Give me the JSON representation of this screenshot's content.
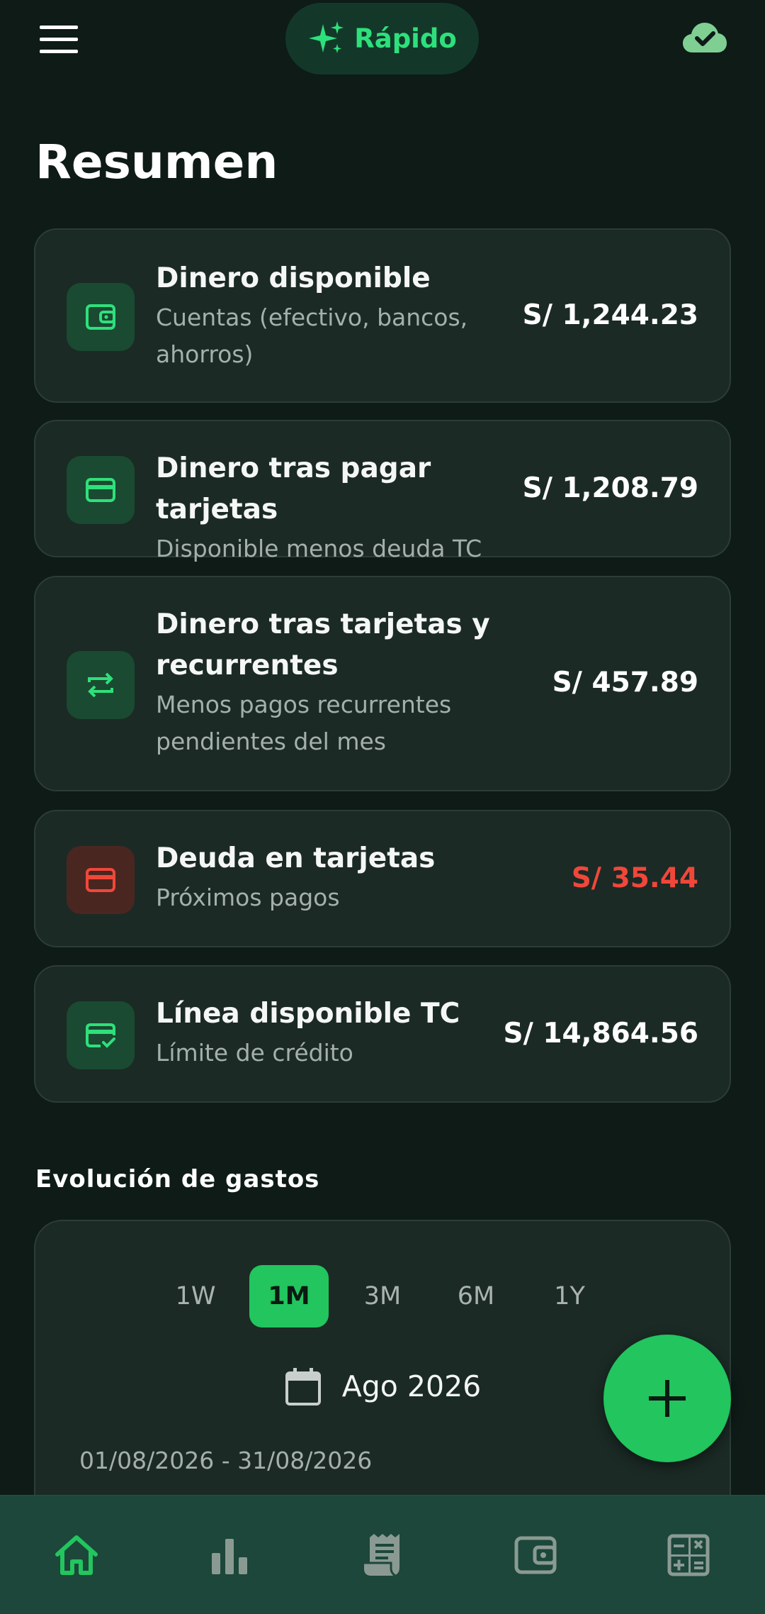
{
  "header": {
    "quick_label": "Rápido"
  },
  "page": {
    "title": "Resumen"
  },
  "summary": [
    {
      "label": "Dinero disponible",
      "sub": "Cuentas (efectivo, bancos, ahorros)",
      "amount": "S/ 1,244.23",
      "icon": "wallet-icon"
    },
    {
      "label": "Dinero tras pagar tarjetas",
      "sub": "Disponible menos deuda TC",
      "amount": "S/ 1,208.79",
      "icon": "credit-card-icon"
    },
    {
      "label": "Dinero tras tarjetas y recurrentes",
      "sub": "Menos pagos recurrentes pendientes del mes",
      "amount": "S/ 457.89",
      "icon": "repeat-icon"
    },
    {
      "label": "Deuda en tarjetas",
      "sub": "Próximos pagos",
      "amount": "S/ 35.44",
      "icon": "credit-card-icon"
    },
    {
      "label": "Línea disponible TC",
      "sub": "Límite de crédito",
      "amount": "S/ 14,864.56",
      "icon": "card-check-icon"
    }
  ],
  "evolution": {
    "title": "Evolución de gastos",
    "ranges": [
      "1W",
      "1M",
      "3M",
      "6M",
      "1Y"
    ],
    "active_range": "1M",
    "month": "Ago 2026",
    "date_range": "01/08/2026 - 31/08/2026"
  },
  "colors": {
    "accent": "#22c55e",
    "negative": "#f0473a",
    "background": "#0e1b17",
    "nav": "#1c473a"
  },
  "nav": [
    {
      "icon": "home-icon",
      "active": true
    },
    {
      "icon": "bar-chart-icon",
      "active": false
    },
    {
      "icon": "receipt-icon",
      "active": false
    },
    {
      "icon": "wallet-icon",
      "active": false
    },
    {
      "icon": "calculator-icon",
      "active": false
    }
  ]
}
